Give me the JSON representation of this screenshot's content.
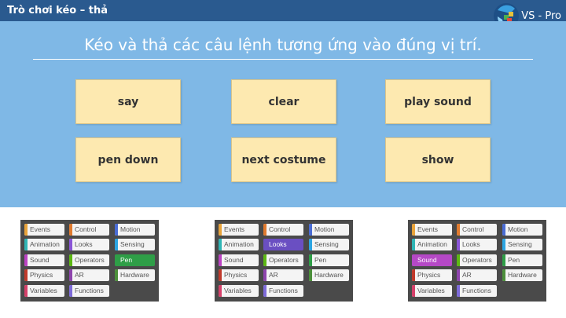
{
  "header": {
    "title": "Trò chơi kéo – thả",
    "logo_text": "VS - Pro"
  },
  "main": {
    "instruction": "Kéo và thả các câu lệnh tương ứng vào đúng vị trí.",
    "cards": [
      "say",
      "clear",
      "play sound",
      "pen down",
      "next costume",
      "show"
    ]
  },
  "palettes": [
    {
      "selected": "Pen",
      "categories": [
        {
          "label": "Events",
          "color": "#e8a33a"
        },
        {
          "label": "Control",
          "color": "#e07a2e"
        },
        {
          "label": "Motion",
          "color": "#4a6cd4"
        },
        {
          "label": "Animation",
          "color": "#2fb5b5"
        },
        {
          "label": "Looks",
          "color": "#8a55d7"
        },
        {
          "label": "Sensing",
          "color": "#2ca5e2"
        },
        {
          "label": "Sound",
          "color": "#bb42c3"
        },
        {
          "label": "Operators",
          "color": "#5cb712"
        },
        {
          "label": "Pen",
          "color": "#2e9e47"
        },
        {
          "label": "Physics",
          "color": "#c0392b"
        },
        {
          "label": "AR",
          "color": "#8e44ad"
        },
        {
          "label": "Hardware",
          "color": "#4b8f3a"
        },
        {
          "label": "Variables",
          "color": "#d6406a"
        },
        {
          "label": "Functions",
          "color": "#7d6ad9"
        }
      ]
    },
    {
      "selected": "Looks",
      "categories": [
        {
          "label": "Events",
          "color": "#e8a33a"
        },
        {
          "label": "Control",
          "color": "#e07a2e"
        },
        {
          "label": "Motion",
          "color": "#4a6cd4"
        },
        {
          "label": "Animation",
          "color": "#2fb5b5"
        },
        {
          "label": "Looks",
          "color": "#6a4fc2"
        },
        {
          "label": "Sensing",
          "color": "#2ca5e2"
        },
        {
          "label": "Sound",
          "color": "#bb42c3"
        },
        {
          "label": "Operators",
          "color": "#5cb712"
        },
        {
          "label": "Pen",
          "color": "#2e9e47"
        },
        {
          "label": "Physics",
          "color": "#c0392b"
        },
        {
          "label": "AR",
          "color": "#8e44ad"
        },
        {
          "label": "Hardware",
          "color": "#4b8f3a"
        },
        {
          "label": "Variables",
          "color": "#d6406a"
        },
        {
          "label": "Functions",
          "color": "#7d6ad9"
        }
      ]
    },
    {
      "selected": "Sound",
      "categories": [
        {
          "label": "Events",
          "color": "#e8a33a"
        },
        {
          "label": "Control",
          "color": "#e07a2e"
        },
        {
          "label": "Motion",
          "color": "#4a6cd4"
        },
        {
          "label": "Animation",
          "color": "#2fb5b5"
        },
        {
          "label": "Looks",
          "color": "#8a55d7"
        },
        {
          "label": "Sensing",
          "color": "#2ca5e2"
        },
        {
          "label": "Sound",
          "color": "#b548c6"
        },
        {
          "label": "Operators",
          "color": "#5cb712"
        },
        {
          "label": "Pen",
          "color": "#2e9e47"
        },
        {
          "label": "Physics",
          "color": "#c0392b"
        },
        {
          "label": "AR",
          "color": "#8e44ad"
        },
        {
          "label": "Hardware",
          "color": "#4b8f3a"
        },
        {
          "label": "Variables",
          "color": "#d6406a"
        },
        {
          "label": "Functions",
          "color": "#7d6ad9"
        }
      ]
    }
  ]
}
